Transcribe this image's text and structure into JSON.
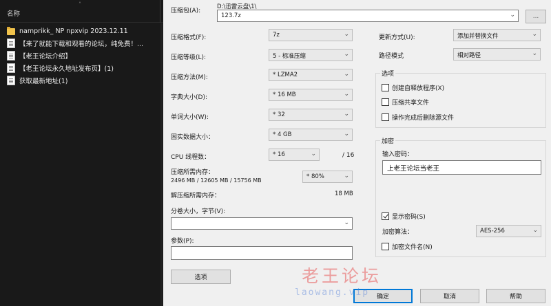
{
  "explorer": {
    "column_header": "名称",
    "files": [
      {
        "icon": "folder-icon",
        "name": "namprikk_ NP npxvip 2023.12.11"
      },
      {
        "icon": "document-icon",
        "name": "【来了就能下载和观看的论坛，纯免费！..."
      },
      {
        "icon": "document-icon",
        "name": "【老王论坛介绍】"
      },
      {
        "icon": "document-icon",
        "name": "【老王论坛永久地址发布页】(1)"
      },
      {
        "icon": "document-icon",
        "name": "获取最新地址(1)"
      }
    ]
  },
  "dialog": {
    "archive_label": "压缩包(A):",
    "archive_path": "D:\\迅雷云盘\\1\\",
    "archive_name": "123.7z",
    "browse_label": "...",
    "format_label": "压缩格式(F):",
    "format_value": "7z",
    "level_label": "压缩等级(L):",
    "level_value": "5 - 标准压缩",
    "method_label": "压缩方法(M):",
    "method_value": "* LZMA2",
    "dict_label": "字典大小(D):",
    "dict_value": "* 16 MB",
    "word_label": "单词大小(W):",
    "word_value": "* 32",
    "solid_label": "固实数据大小：",
    "solid_value": "* 4 GB",
    "cpu_label": "CPU 线程数：",
    "cpu_value": "* 16",
    "cpu_total": "/ 16",
    "mem_compress_label": "压缩所需内存：",
    "mem_compress_detail": "2496 MB / 12605 MB / 15756 MB",
    "mem_percent_value": "* 80%",
    "mem_decompress_label": "解压缩所需内存：",
    "mem_decompress_value": "18 MB",
    "volume_label": "分卷大小，字节(V):",
    "volume_value": "",
    "params_label": "参数(P):",
    "params_value": "",
    "options_button": "选项",
    "update_label": "更新方式(U):",
    "update_value": "添加并替换文件",
    "pathmode_label": "路径模式",
    "pathmode_value": "相对路径",
    "options_group": "选项",
    "opt_sfx": "创建自释放程序(X)",
    "opt_shared": "压缩共享文件",
    "opt_delete": "操作完成后删除源文件",
    "encrypt_group": "加密",
    "password_label": "输入密码：",
    "password_value": "上老王论坛当老王",
    "show_password": "显示密码(S)",
    "enc_method_label": "加密算法：",
    "enc_method_value": "AES-256",
    "encrypt_names": "加密文件名(N)",
    "ok_button": "确定",
    "cancel_button": "取消",
    "help_button": "帮助"
  },
  "watermark": {
    "text": "老王论坛",
    "url": "laowang.vip"
  }
}
